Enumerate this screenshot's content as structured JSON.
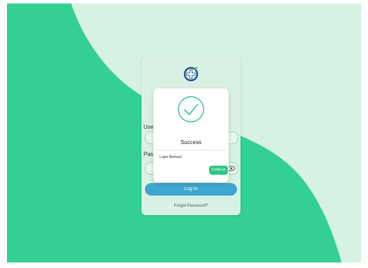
{
  "colors": {
    "background_light": "#d6f2e3",
    "background_blob": "#34d092",
    "card": "#d8f1e4",
    "login_button": "#3fa6cf",
    "continue_button": "#2fc587",
    "check": "#2fc587"
  },
  "login_form": {
    "logo_icon": "medical-cross-icon",
    "username_label": "Use",
    "password_label": "Pas",
    "password_toggle_icon": "eye-icon",
    "login_button_label": "Log In",
    "forgot_password_label": "Forgot Password?"
  },
  "dialog": {
    "icon": "check-circle-icon",
    "title": "Success",
    "message": "Login Berhasil",
    "continue_label": "Continue"
  }
}
